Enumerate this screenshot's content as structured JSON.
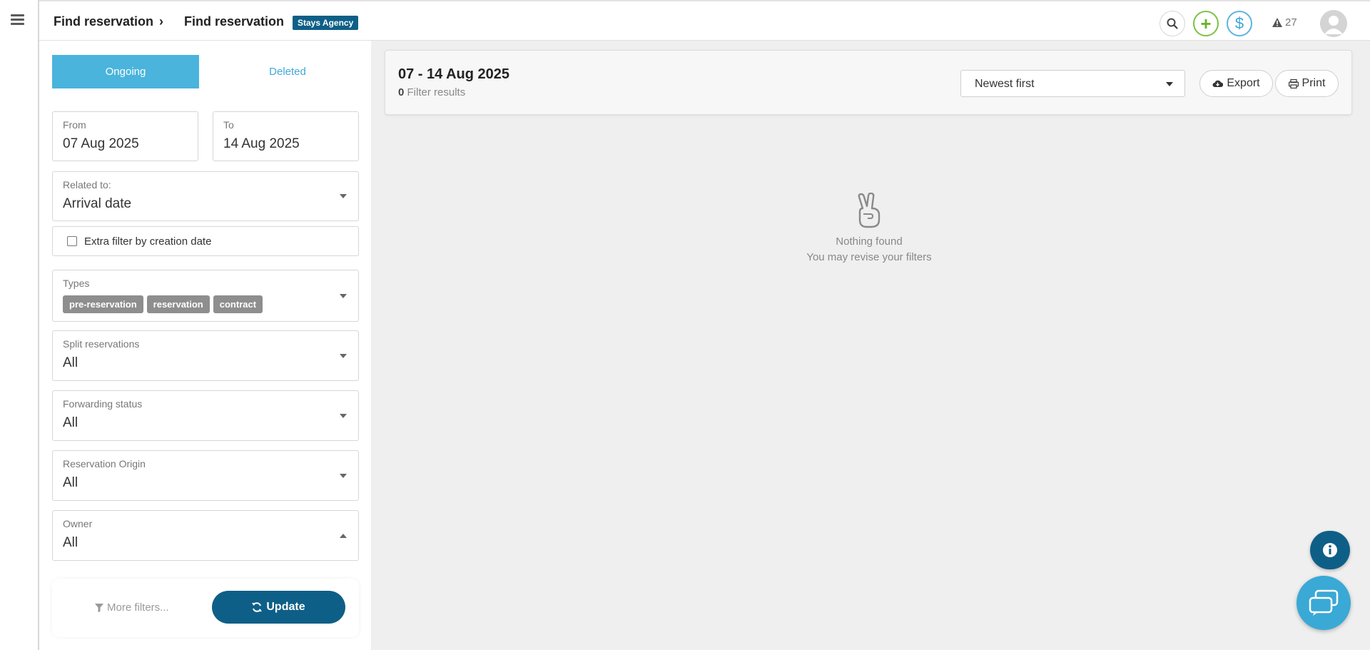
{
  "header": {
    "breadcrumb": [
      "Find reservation",
      "Find reservation"
    ],
    "separator": "›",
    "agency_badge": "Stays Agency",
    "alerts_count": "27",
    "colors": {
      "brand": "#0e5f87",
      "accent": "#4ab4dc",
      "plus": "#7cc243",
      "dollar": "#3da4d6"
    }
  },
  "icons": {
    "menu": "hamburger-icon",
    "search": "search-icon",
    "plus": "plus-icon",
    "dollar": "dollar-icon",
    "alert": "warning-icon",
    "avatar": "user-avatar-icon",
    "filter": "filter-icon",
    "refresh": "refresh-icon",
    "export": "cloud-download-icon",
    "print": "print-icon",
    "empty": "peace-hand-icon",
    "info": "info-icon",
    "chat": "chat-icon",
    "plus_glyph": "+",
    "dollar_glyph": "$"
  },
  "filters": {
    "tabs": [
      {
        "label": "Ongoing",
        "active": true
      },
      {
        "label": "Deleted",
        "active": false
      }
    ],
    "from": {
      "label": "From",
      "value": "07 Aug 2025"
    },
    "to": {
      "label": "To",
      "value": "14 Aug 2025"
    },
    "related_to": {
      "label": "Related to:",
      "value": "Arrival date"
    },
    "extra_filter": {
      "label": "Extra filter by creation date",
      "checked": false
    },
    "types": {
      "label": "Types",
      "tags": [
        "pre-reservation",
        "reservation",
        "contract"
      ]
    },
    "split": {
      "label": "Split reservations",
      "value": "All"
    },
    "forwarding": {
      "label": "Forwarding status",
      "value": "All"
    },
    "origin": {
      "label": "Reservation Origin",
      "value": "All"
    },
    "owner": {
      "label": "Owner",
      "value": "All"
    },
    "more_filters": "More filters...",
    "update": "Update"
  },
  "results": {
    "title": "07 - 14 Aug 2025",
    "count": "0",
    "count_suffix": "Filter results",
    "sort": "Newest first",
    "export": "Export",
    "print": "Print",
    "empty_title": "Nothing found",
    "empty_hint": "You may revise your filters"
  }
}
